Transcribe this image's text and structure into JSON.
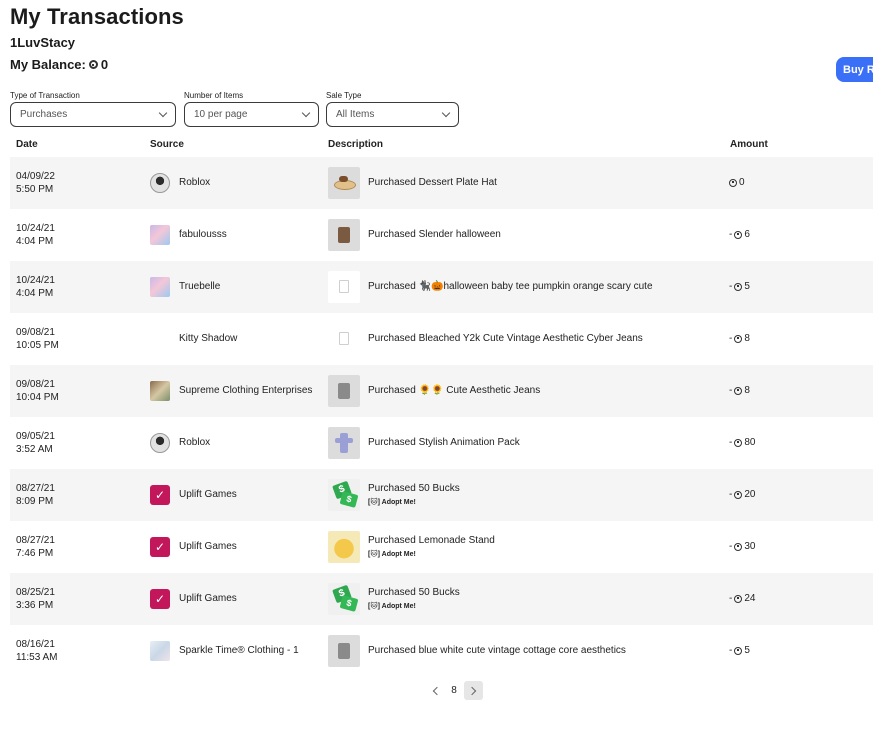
{
  "header": {
    "title": "My Transactions",
    "username": "1LuvStacy",
    "balance_label": "My Balance:",
    "balance_value": "0",
    "buy_button_label": "Buy Robux"
  },
  "filters": {
    "transaction_type": {
      "label": "Type of Transaction",
      "value": "Purchases"
    },
    "items_count": {
      "label": "Number of Items",
      "value": "10 per page"
    },
    "sale_type": {
      "label": "Sale Type",
      "value": "All Items"
    }
  },
  "table": {
    "columns": [
      "Date",
      "Source",
      "Description",
      "Amount"
    ],
    "rows": [
      {
        "date": "04/09/22",
        "time": "5:50 PM",
        "source": "Roblox",
        "description": "Purchased Dessert Plate Hat",
        "sub": "",
        "amount": "0"
      },
      {
        "date": "10/24/21",
        "time": "4:04 PM",
        "source": "fabulousss",
        "description": "Purchased Slender halloween",
        "sub": "",
        "amount": "6"
      },
      {
        "date": "10/24/21",
        "time": "4:04 PM",
        "source": "Truebelle",
        "description": "Purchased 🐈‍⬛🎃halloween baby tee pumpkin orange scary cute",
        "sub": "",
        "amount": "5"
      },
      {
        "date": "09/08/21",
        "time": "10:05 PM",
        "source": "Kitty Shadow",
        "description": "Purchased Bleached Y2k Cute Vintage Aesthetic Cyber Jeans",
        "sub": "",
        "amount": "8"
      },
      {
        "date": "09/08/21",
        "time": "10:04 PM",
        "source": "Supreme Clothing Enterprises",
        "description": "Purchased 🌻🌻 Cute Aesthetic Jeans",
        "sub": "",
        "amount": "8"
      },
      {
        "date": "09/05/21",
        "time": "3:52 AM",
        "source": "Roblox",
        "description": "Purchased Stylish Animation Pack",
        "sub": "",
        "amount": "80"
      },
      {
        "date": "08/27/21",
        "time": "8:09 PM",
        "source": "Uplift Games",
        "description": "Purchased 50 Bucks",
        "sub": "[🐱] Adopt Me!",
        "amount": "20"
      },
      {
        "date": "08/27/21",
        "time": "7:46 PM",
        "source": "Uplift Games",
        "description": "Purchased Lemonade Stand",
        "sub": "[🐱] Adopt Me!",
        "amount": "30"
      },
      {
        "date": "08/25/21",
        "time": "3:36 PM",
        "source": "Uplift Games",
        "description": "Purchased 50 Bucks",
        "sub": "[🐱] Adopt Me!",
        "amount": "24"
      },
      {
        "date": "08/16/21",
        "time": "11:53 AM",
        "source": "Sparkle Time® Clothing - 1",
        "description": "Purchased blue white cute vintage cottage core aesthetics",
        "sub": "",
        "amount": "5"
      }
    ]
  },
  "pagination": {
    "current_page": "8"
  }
}
